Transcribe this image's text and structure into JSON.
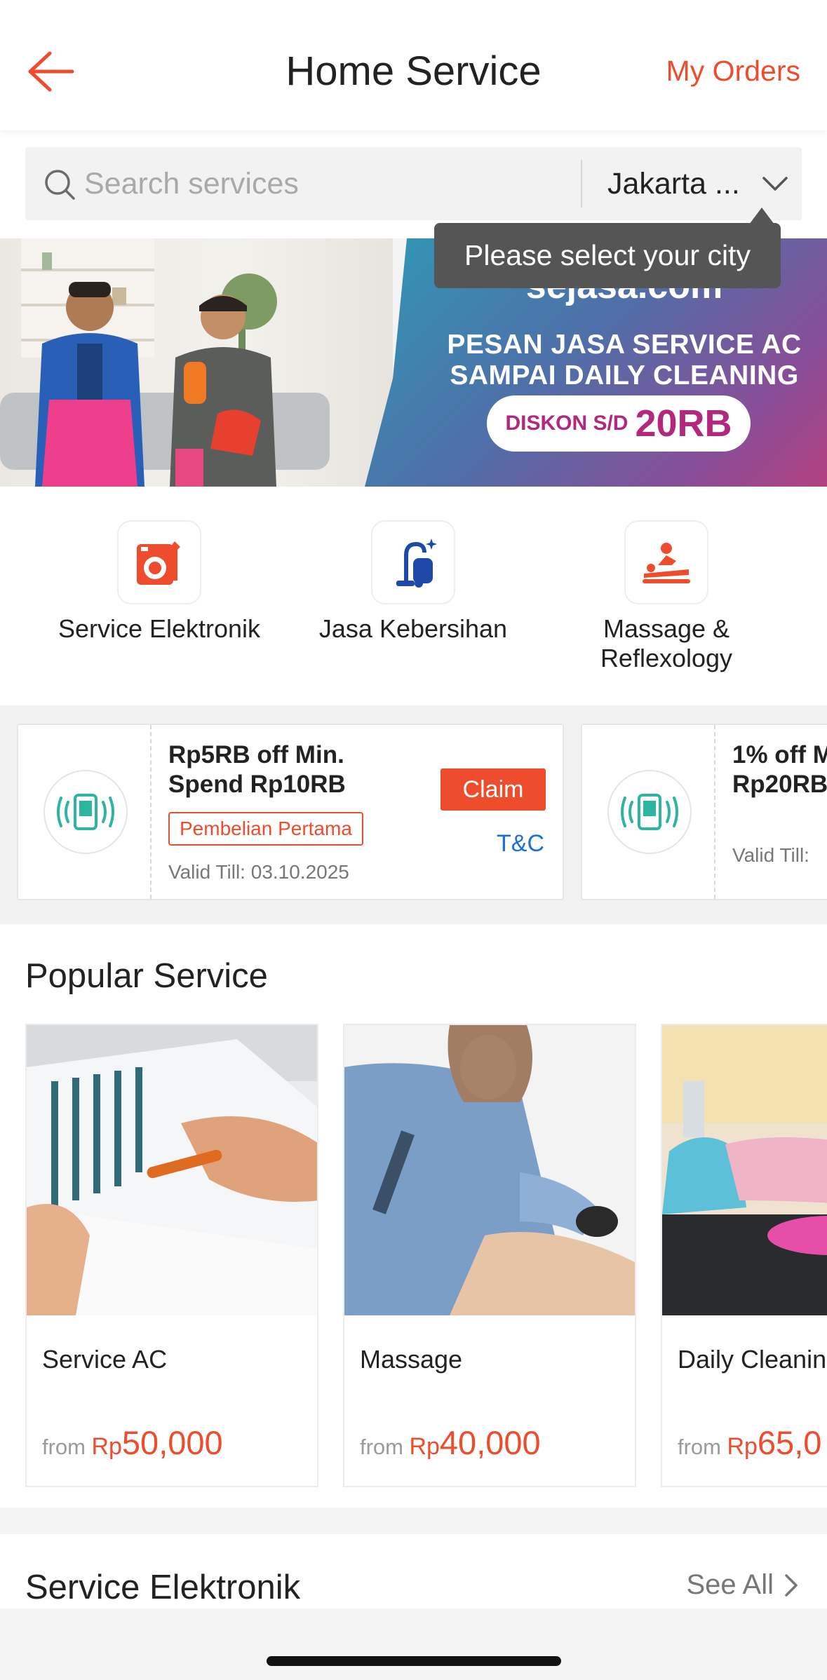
{
  "header": {
    "title": "Home Service",
    "my_orders": "My Orders"
  },
  "search": {
    "placeholder": "Search services",
    "city": "Jakarta ...",
    "tooltip": "Please select your city"
  },
  "banner": {
    "logo": "sejasa.com",
    "line1": "PESAN JASA SERVICE AC",
    "line2": "SAMPAI DAILY CLEANING",
    "pill_small": "DISKON S/D",
    "pill_big": "20RB",
    "slide_count": 2,
    "active_slide": 2
  },
  "categories": [
    {
      "label": "Service Elektronik",
      "icon": "washing-machine-icon"
    },
    {
      "label": "Jasa Kebersihan",
      "icon": "vacuum-cleaner-icon"
    },
    {
      "label": "Massage & Reflexology",
      "icon": "massage-icon"
    }
  ],
  "vouchers": [
    {
      "title": "Rp5RB off Min. Spend Rp10RB",
      "tag": "Pembelian Pertama",
      "valid": "Valid Till: 03.10.2025",
      "claim": "Claim",
      "tnc": "T&C"
    },
    {
      "title": "1% off M Rp20RB",
      "valid": "Valid Till:"
    }
  ],
  "popular": {
    "title": "Popular Service",
    "items": [
      {
        "name": "Service AC",
        "from": "from",
        "currency": "Rp",
        "price": "50,000"
      },
      {
        "name": "Massage",
        "from": "from",
        "currency": "Rp",
        "price": "40,000"
      },
      {
        "name": "Daily Cleanin",
        "from": "from",
        "currency": "Rp",
        "price": "65,0"
      }
    ]
  },
  "elektronik": {
    "title": "Service Elektronik",
    "see_all": "See All"
  },
  "colors": {
    "accent": "#ee4d2d",
    "link": "#1a6fd8",
    "teal_icon": "#2cb5a0"
  }
}
